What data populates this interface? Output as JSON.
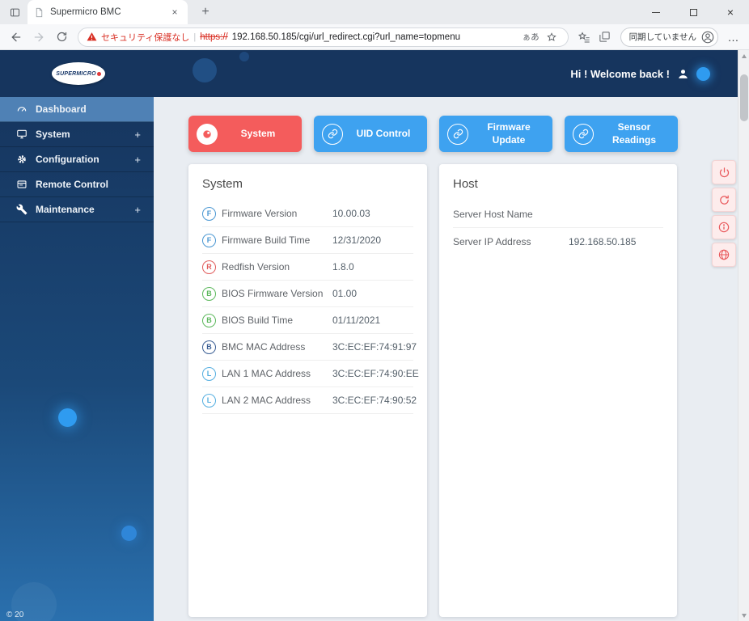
{
  "browser": {
    "tab_title": "Supermicro BMC",
    "tab_close": "×",
    "new_tab": "+",
    "window_close": "×",
    "address": {
      "security_warning": "セキュリティ保護なし",
      "divider": "|",
      "protocol": "https://",
      "url": "192.168.50.185/cgi/url_redirect.cgi?url_name=topmenu",
      "read_aloud": "ぁあ"
    },
    "profile_label": "同期していません",
    "more": "…"
  },
  "app": {
    "brand": "SUPERMICRO",
    "welcome": "Hi ! Welcome back !",
    "sidebar": {
      "items": [
        {
          "label": "Dashboard",
          "expand": ""
        },
        {
          "label": "System",
          "expand": "+"
        },
        {
          "label": "Configuration",
          "expand": "+"
        },
        {
          "label": "Remote Control",
          "expand": ""
        },
        {
          "label": "Maintenance",
          "expand": "+"
        }
      ],
      "footer_fragment": "© 20"
    },
    "quick_buttons": [
      {
        "label": "System"
      },
      {
        "label": "UID Control"
      },
      {
        "label": "Firmware Update"
      },
      {
        "label": "Sensor Readings"
      }
    ],
    "system_card": {
      "title": "System",
      "rows": [
        {
          "badge": "F",
          "color": "#4a97d2",
          "label": "Firmware Version",
          "value": "10.00.03"
        },
        {
          "badge": "F",
          "color": "#4a97d2",
          "label": "Firmware Build Time",
          "value": "12/31/2020"
        },
        {
          "badge": "R",
          "color": "#e05b5b",
          "label": "Redfish Version",
          "value": "1.8.0"
        },
        {
          "badge": "B",
          "color": "#5cb85c",
          "label": "BIOS Firmware Version",
          "value": "01.00"
        },
        {
          "badge": "B",
          "color": "#5cb85c",
          "label": "BIOS Build Time",
          "value": "01/11/2021"
        },
        {
          "badge": "B",
          "color": "#3a5e94",
          "label": "BMC MAC Address",
          "value": "3C:EC:EF:74:91:97"
        },
        {
          "badge": "L",
          "color": "#54aee0",
          "label": "LAN 1 MAC Address",
          "value": "3C:EC:EF:74:90:EE"
        },
        {
          "badge": "L",
          "color": "#54aee0",
          "label": "LAN 2 MAC Address",
          "value": "3C:EC:EF:74:90:52"
        }
      ]
    },
    "host_card": {
      "title": "Host",
      "rows": [
        {
          "label": "Server Host Name",
          "value": ""
        },
        {
          "label": "Server IP Address",
          "value": "192.168.50.185"
        }
      ]
    },
    "colors": {
      "header_navy": "#16355e",
      "sidebar_active": "#4f81b5",
      "accent_red": "#f45c5c",
      "accent_blue": "#3ea2f0"
    }
  }
}
